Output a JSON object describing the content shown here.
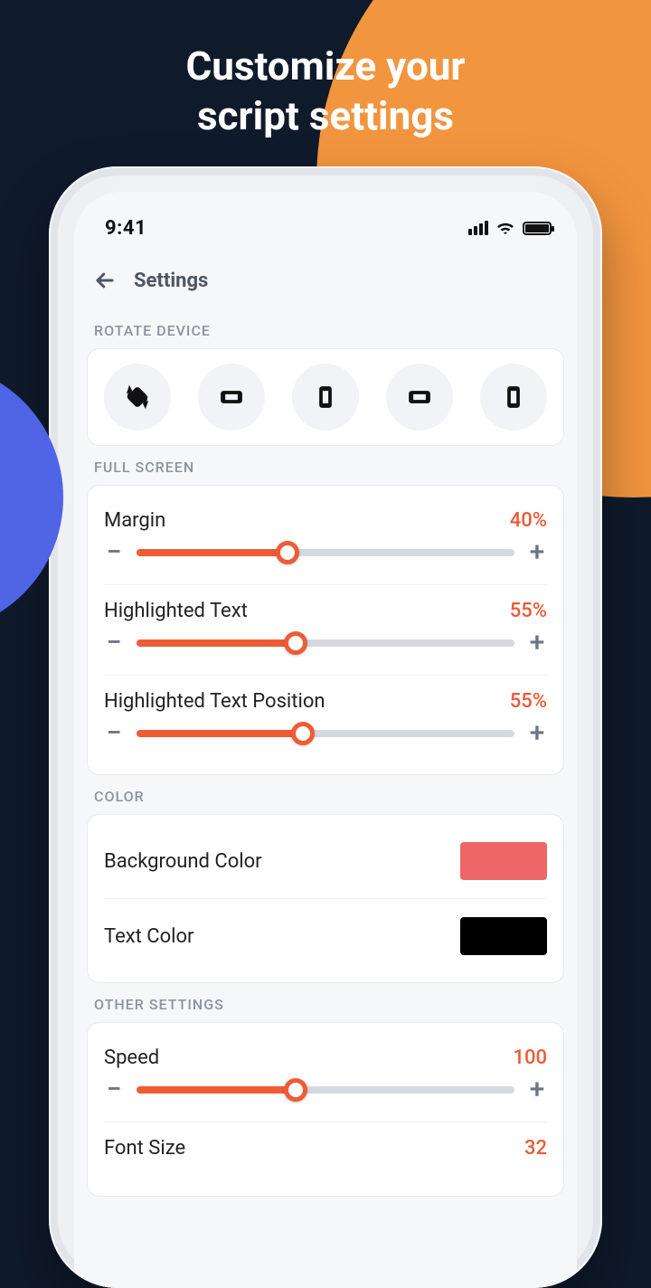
{
  "hero": {
    "line1": "Customize your",
    "line2": "script settings"
  },
  "status": {
    "time": "9:41"
  },
  "header": {
    "title": "Settings"
  },
  "sections": {
    "rotate": {
      "label": "ROTATE DEVICE"
    },
    "fullscreen": {
      "label": "FULL SCREEN",
      "items": [
        {
          "label": "Margin",
          "value": "40%",
          "percent": 40
        },
        {
          "label": "Highlighted Text",
          "value": "55%",
          "percent": 42
        },
        {
          "label": "Highlighted Text Position",
          "value": "55%",
          "percent": 44
        }
      ]
    },
    "color": {
      "label": "COLOR",
      "items": [
        {
          "label": "Background Color",
          "swatch": "#ec6666"
        },
        {
          "label": "Text Color",
          "swatch": "#000000"
        }
      ]
    },
    "other": {
      "label": "OTHER SETTINGS",
      "items": [
        {
          "label": "Speed",
          "value": "100",
          "percent": 42
        },
        {
          "label": "Font Size",
          "value": "32"
        }
      ]
    }
  },
  "rotate_options": [
    "rotate-auto",
    "landscape-left",
    "portrait",
    "landscape-right",
    "portrait-up"
  ]
}
